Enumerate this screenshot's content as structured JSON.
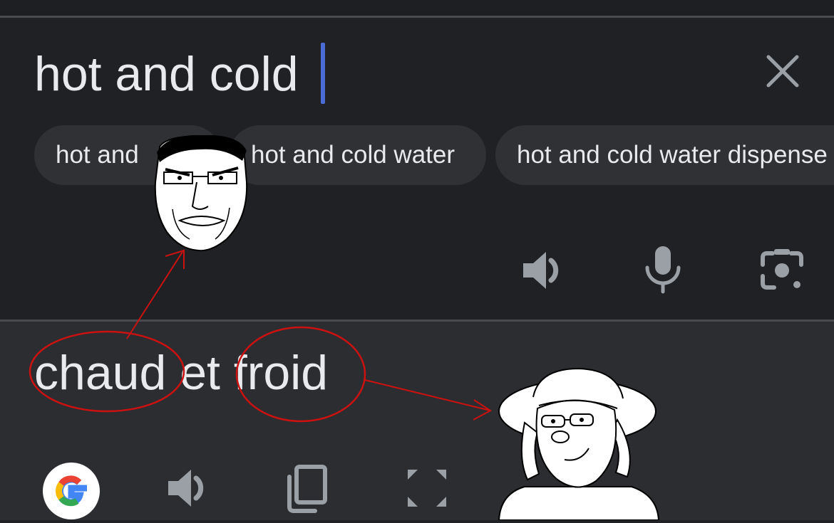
{
  "source": {
    "text": "hot and cold"
  },
  "suggestions": [
    {
      "label": "hot and"
    },
    {
      "label": "hot and cold water"
    },
    {
      "label": "hot and cold water dispense"
    }
  ],
  "translation": {
    "word1": "chaud",
    "word2": "et",
    "word3": "froid"
  },
  "icons": {
    "clear": "close-icon",
    "speaker": "speaker-icon",
    "mic": "microphone-icon",
    "lens": "camera-lens-icon",
    "google": "google-g-logo",
    "copy": "copy-icon",
    "fullscreen": "fullscreen-icon"
  },
  "colors": {
    "background": "#202124",
    "target_background": "#2c2d31",
    "chip": "#303134",
    "text": "#e8eaed",
    "icon": "#9aa0a6",
    "cursor": "#4b6bd6",
    "annotation": "#cc1111"
  }
}
